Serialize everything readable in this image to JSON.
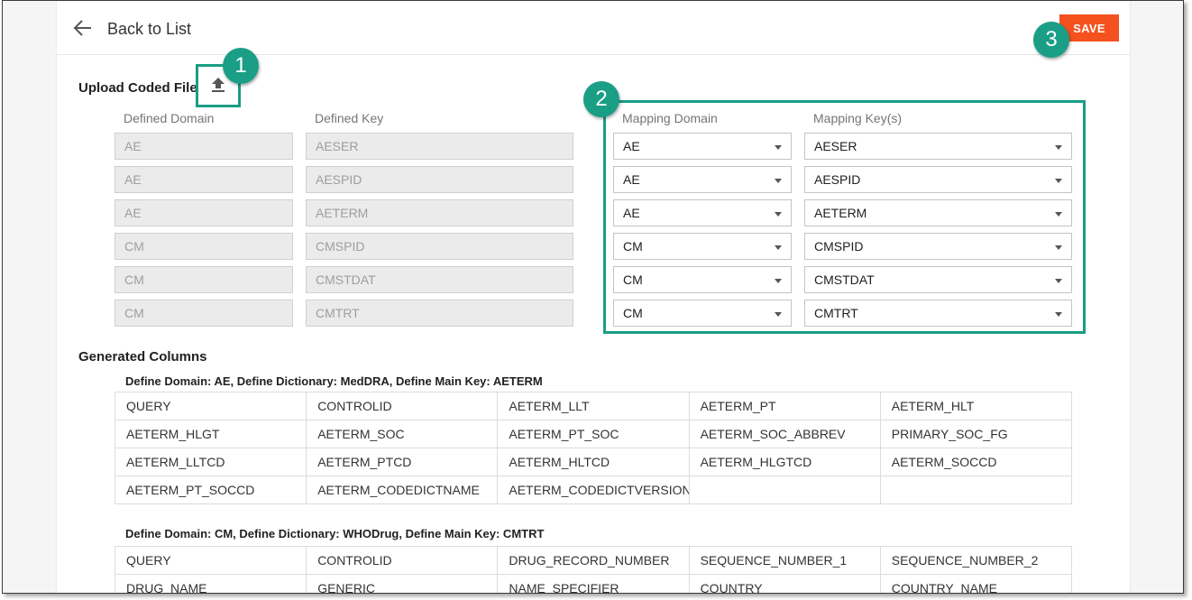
{
  "header": {
    "back_label": "Back to List",
    "save_label": "SAVE"
  },
  "upload": {
    "title": "Upload Coded File"
  },
  "defined": {
    "domain_header": "Defined Domain",
    "key_header": "Defined Key",
    "rows": [
      {
        "domain": "AE",
        "key": "AESER"
      },
      {
        "domain": "AE",
        "key": "AESPID"
      },
      {
        "domain": "AE",
        "key": "AETERM"
      },
      {
        "domain": "CM",
        "key": "CMSPID"
      },
      {
        "domain": "CM",
        "key": "CMSTDAT"
      },
      {
        "domain": "CM",
        "key": "CMTRT"
      }
    ]
  },
  "mapping": {
    "domain_header": "Mapping Domain",
    "key_header": "Mapping Key(s)",
    "rows": [
      {
        "domain": "AE",
        "key": "AESER"
      },
      {
        "domain": "AE",
        "key": "AESPID"
      },
      {
        "domain": "AE",
        "key": "AETERM"
      },
      {
        "domain": "CM",
        "key": "CMSPID"
      },
      {
        "domain": "CM",
        "key": "CMSTDAT"
      },
      {
        "domain": "CM",
        "key": "CMTRT"
      }
    ]
  },
  "badges": [
    "1",
    "2",
    "3"
  ],
  "generated": {
    "title": "Generated Columns",
    "groups": [
      {
        "title": "Define Domain: AE, Define Dictionary: MedDRA, Define Main Key: AETERM",
        "rows": [
          [
            "QUERY",
            "CONTROLID",
            "AETERM_LLT",
            "AETERM_PT",
            "AETERM_HLT"
          ],
          [
            "AETERM_HLGT",
            "AETERM_SOC",
            "AETERM_PT_SOC",
            "AETERM_SOC_ABBREV",
            "PRIMARY_SOC_FG"
          ],
          [
            "AETERM_LLTCD",
            "AETERM_PTCD",
            "AETERM_HLTCD",
            "AETERM_HLGTCD",
            "AETERM_SOCCD"
          ],
          [
            "AETERM_PT_SOCCD",
            "AETERM_CODEDICTNAME",
            "AETERM_CODEDICTVERSION",
            "",
            ""
          ]
        ]
      },
      {
        "title": "Define Domain: CM, Define Dictionary: WHODrug, Define Main Key: CMTRT",
        "rows": [
          [
            "QUERY",
            "CONTROLID",
            "DRUG_RECORD_NUMBER",
            "SEQUENCE_NUMBER_1",
            "SEQUENCE_NUMBER_2"
          ],
          [
            "DRUG_NAME",
            "GENERIC",
            "NAME_SPECIFIER",
            "COUNTRY",
            "COUNTRY_NAME"
          ]
        ]
      }
    ]
  },
  "colors": {
    "accent": "#1a9e86",
    "save": "#f4511e"
  }
}
